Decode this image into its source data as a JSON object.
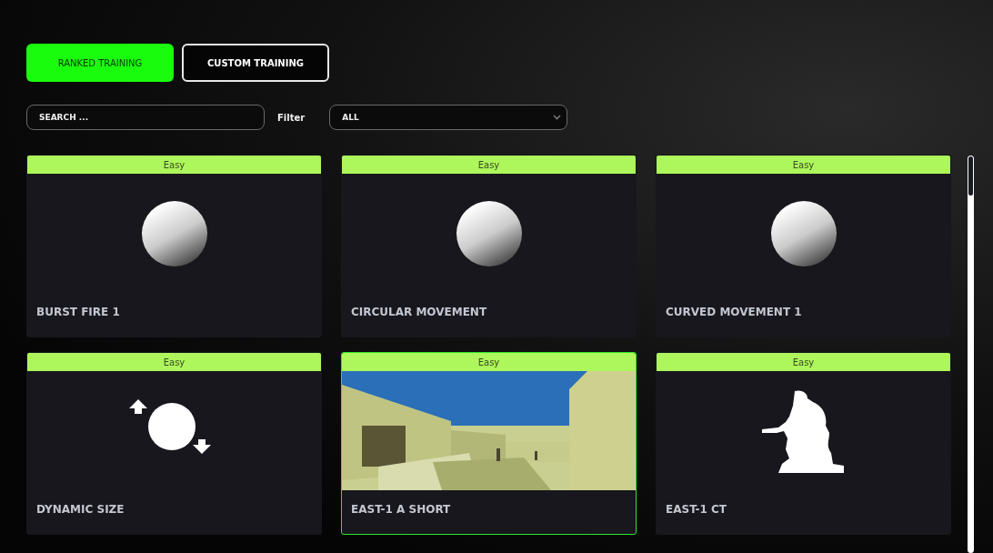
{
  "tabs": [
    {
      "label": "RANKED TRAINING",
      "selected": true
    },
    {
      "label": "CUSTOM TRAINING",
      "selected": false
    }
  ],
  "search": {
    "placeholder": "SEARCH ..."
  },
  "filter": {
    "label": "Filter",
    "value": "ALL"
  },
  "cards": [
    {
      "difficulty": "Easy",
      "title": "BURST FIRE 1",
      "kind": "sphere",
      "selected": false
    },
    {
      "difficulty": "Easy",
      "title": "CIRCULAR MOVEMENT",
      "kind": "sphere",
      "selected": false
    },
    {
      "difficulty": "Easy",
      "title": "CURVED MOVEMENT 1",
      "kind": "sphere",
      "selected": false
    },
    {
      "difficulty": "Easy",
      "title": "DYNAMIC SIZE",
      "kind": "resize",
      "selected": false
    },
    {
      "difficulty": "Easy",
      "title": "EAST-1 A SHORT",
      "kind": "picture",
      "selected": true
    },
    {
      "difficulty": "Easy",
      "title": "EAST-1 CT",
      "kind": "soldier",
      "selected": false
    }
  ]
}
